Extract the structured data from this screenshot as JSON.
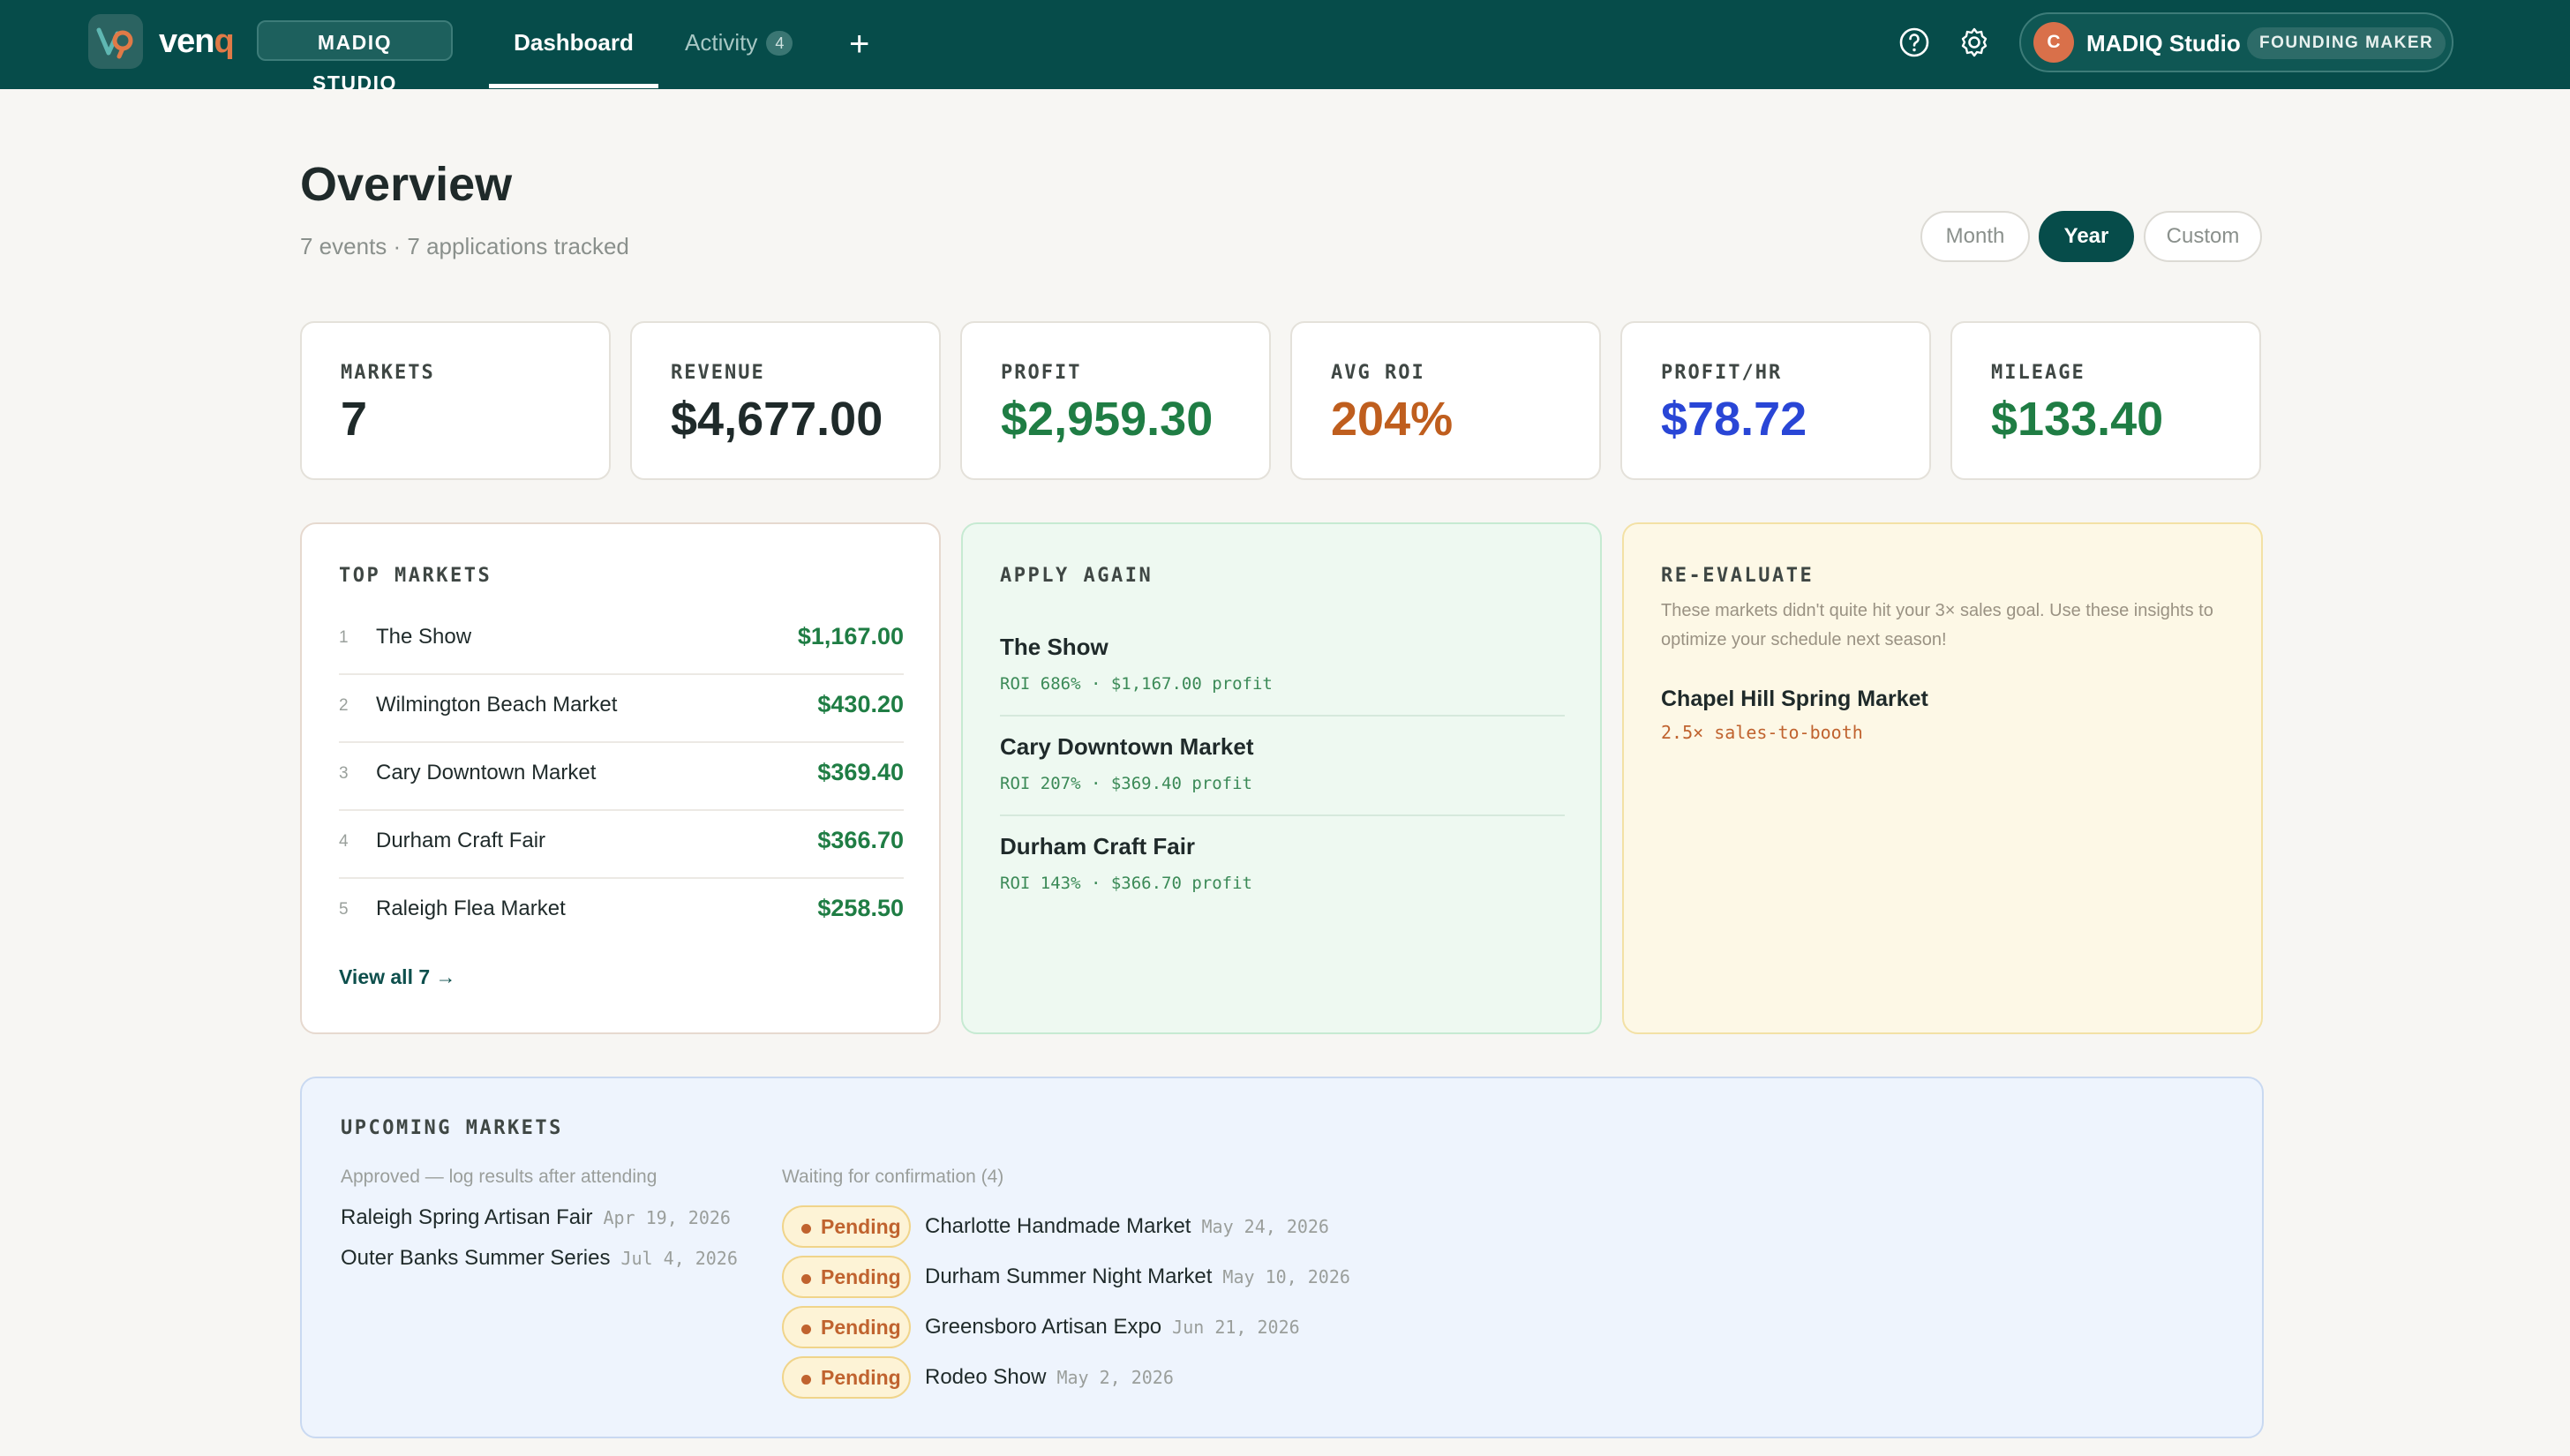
{
  "nav": {
    "brand_main": "ven",
    "brand_accent": "q",
    "studio_label": "MADIQ STUDIO",
    "tabs": [
      {
        "label": "Dashboard",
        "active": true
      },
      {
        "label": "Activity",
        "count": "4",
        "active": false
      }
    ],
    "add_label": "+",
    "user": {
      "initial": "C",
      "name": "MADIQ Studio",
      "badge": "FOUNDING MAKER"
    }
  },
  "header": {
    "title": "Overview",
    "subtitle": "7 events · 7 applications tracked",
    "ranges": [
      {
        "label": "Month",
        "active": false
      },
      {
        "label": "Year",
        "active": true
      },
      {
        "label": "Custom",
        "active": false
      }
    ]
  },
  "stats": [
    {
      "label": "MARKETS",
      "value": "7",
      "color": "#1f2a2a"
    },
    {
      "label": "REVENUE",
      "value": "$4,677.00",
      "color": "#1f2a2a"
    },
    {
      "label": "PROFIT",
      "value": "$2,959.30",
      "color": "#1f7d44"
    },
    {
      "label": "AVG ROI",
      "value": "204%",
      "color": "#bf5e1e"
    },
    {
      "label": "PROFIT/HR",
      "value": "$78.72",
      "color": "#2946d6"
    },
    {
      "label": "MILEAGE",
      "value": "$133.40",
      "color": "#1f7d44"
    }
  ],
  "top_markets": {
    "title": "TOP MARKETS",
    "items": [
      {
        "rank": "1",
        "name": "The Show",
        "amount": "$1,167.00"
      },
      {
        "rank": "2",
        "name": "Wilmington Beach Market",
        "amount": "$430.20"
      },
      {
        "rank": "3",
        "name": "Cary Downtown Market",
        "amount": "$369.40"
      },
      {
        "rank": "4",
        "name": "Durham Craft Fair",
        "amount": "$366.70"
      },
      {
        "rank": "5",
        "name": "Raleigh Flea Market",
        "amount": "$258.50"
      }
    ],
    "view_all": "View all 7 →"
  },
  "apply_again": {
    "title": "APPLY AGAIN",
    "items": [
      {
        "name": "The Show",
        "meta": "ROI 686%  ·  $1,167.00 profit"
      },
      {
        "name": "Cary Downtown Market",
        "meta": "ROI 207%  ·  $369.40 profit"
      },
      {
        "name": "Durham Craft Fair",
        "meta": "ROI 143%  ·  $366.70 profit"
      }
    ]
  },
  "re_evaluate": {
    "title": "RE-EVALUATE",
    "description": "These markets didn't quite hit your 3× sales goal. Use these insights to optimize your schedule next season!",
    "items": [
      {
        "name": "Chapel Hill Spring Market",
        "ratio": "2.5× sales-to-booth"
      }
    ]
  },
  "upcoming": {
    "title": "UPCOMING MARKETS",
    "approved_heading": "Approved — log results after attending",
    "approved": [
      {
        "name": "Raleigh Spring Artisan Fair",
        "date": "Apr 19, 2026"
      },
      {
        "name": "Outer Banks Summer Series",
        "date": "Jul 4, 2026"
      }
    ],
    "waiting_heading": "Waiting for confirmation (4)",
    "pending_label": "Pending",
    "waiting": [
      {
        "name": "Charlotte Handmade Market",
        "date": "May 24, 2026"
      },
      {
        "name": "Durham Summer Night Market",
        "date": "May 10, 2026"
      },
      {
        "name": "Greensboro Artisan Expo",
        "date": "Jun 21, 2026"
      },
      {
        "name": "Rodeo Show",
        "date": "May 2, 2026"
      }
    ]
  }
}
